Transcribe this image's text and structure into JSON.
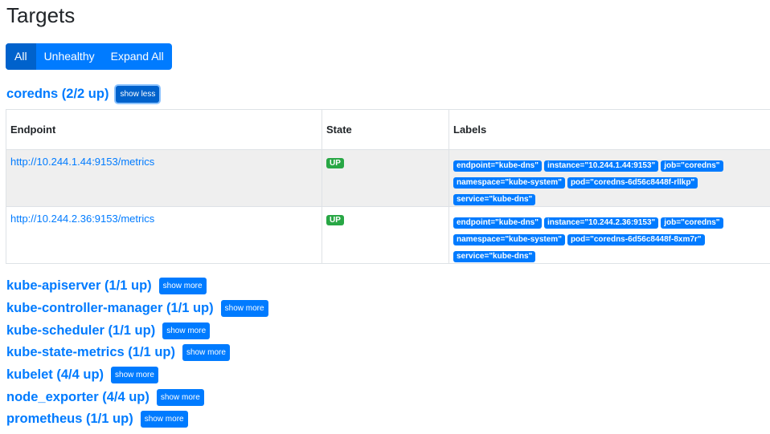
{
  "page": {
    "title": "Targets"
  },
  "filters": [
    {
      "label": "All",
      "active": true
    },
    {
      "label": "Unhealthy",
      "active": false
    },
    {
      "label": "Expand All",
      "active": false
    }
  ],
  "expanded_job": {
    "title": "coredns (2/2 up)",
    "toggle_label": "show less",
    "table": {
      "headers": [
        "Endpoint",
        "State",
        "Labels"
      ],
      "rows": [
        {
          "endpoint": "http://10.244.1.44:9153/metrics",
          "state": "UP",
          "labels": [
            "endpoint=\"kube-dns\"",
            "instance=\"10.244.1.44:9153\"",
            "job=\"coredns\"",
            "namespace=\"kube-system\"",
            "pod=\"coredns-6d56c8448f-rllkp\"",
            "service=\"kube-dns\""
          ]
        },
        {
          "endpoint": "http://10.244.2.36:9153/metrics",
          "state": "UP",
          "labels": [
            "endpoint=\"kube-dns\"",
            "instance=\"10.244.2.36:9153\"",
            "job=\"coredns\"",
            "namespace=\"kube-system\"",
            "pod=\"coredns-6d56c8448f-8xm7r\"",
            "service=\"kube-dns\""
          ]
        }
      ]
    }
  },
  "collapsed_jobs": [
    {
      "title": "kube-apiserver (1/1 up)",
      "toggle_label": "show more"
    },
    {
      "title": "kube-controller-manager (1/1 up)",
      "toggle_label": "show more"
    },
    {
      "title": "kube-scheduler (1/1 up)",
      "toggle_label": "show more"
    },
    {
      "title": "kube-state-metrics (1/1 up)",
      "toggle_label": "show more"
    },
    {
      "title": "kubelet (4/4 up)",
      "toggle_label": "show more"
    },
    {
      "title": "node_exporter (4/4 up)",
      "toggle_label": "show more"
    },
    {
      "title": "prometheus (1/1 up)",
      "toggle_label": "show more"
    }
  ],
  "colors": {
    "primary": "#007bff",
    "primary_active": "#0062cc",
    "success": "#28a745",
    "stripe": "#efefef"
  }
}
